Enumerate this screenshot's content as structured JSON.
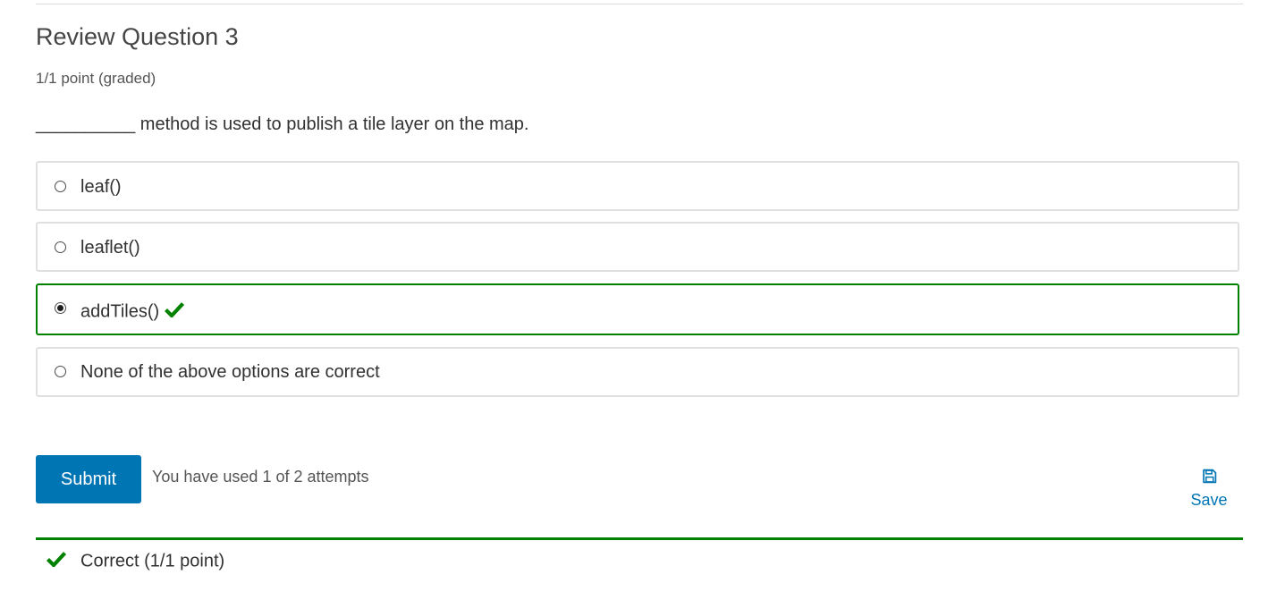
{
  "problem": {
    "title": "Review Question 3",
    "points": "1/1 point (graded)",
    "prompt": "__________ method is used to publish a tile layer on the map."
  },
  "options": [
    {
      "label": "leaf()",
      "selected": false,
      "correct": false
    },
    {
      "label": "leaflet()",
      "selected": false,
      "correct": false
    },
    {
      "label": "addTiles()",
      "selected": true,
      "correct": true
    },
    {
      "label": "None of the above options are correct",
      "selected": false,
      "correct": false
    }
  ],
  "actions": {
    "submit_label": "Submit",
    "attempts_text": "You have used 1 of 2 attempts",
    "save_label": "Save"
  },
  "feedback": {
    "text": "Correct (1/1 point)"
  },
  "colors": {
    "accent": "#0075b4",
    "correct": "#008100"
  },
  "icons": {
    "correct": "check-icon",
    "save": "floppy-disk-icon"
  }
}
